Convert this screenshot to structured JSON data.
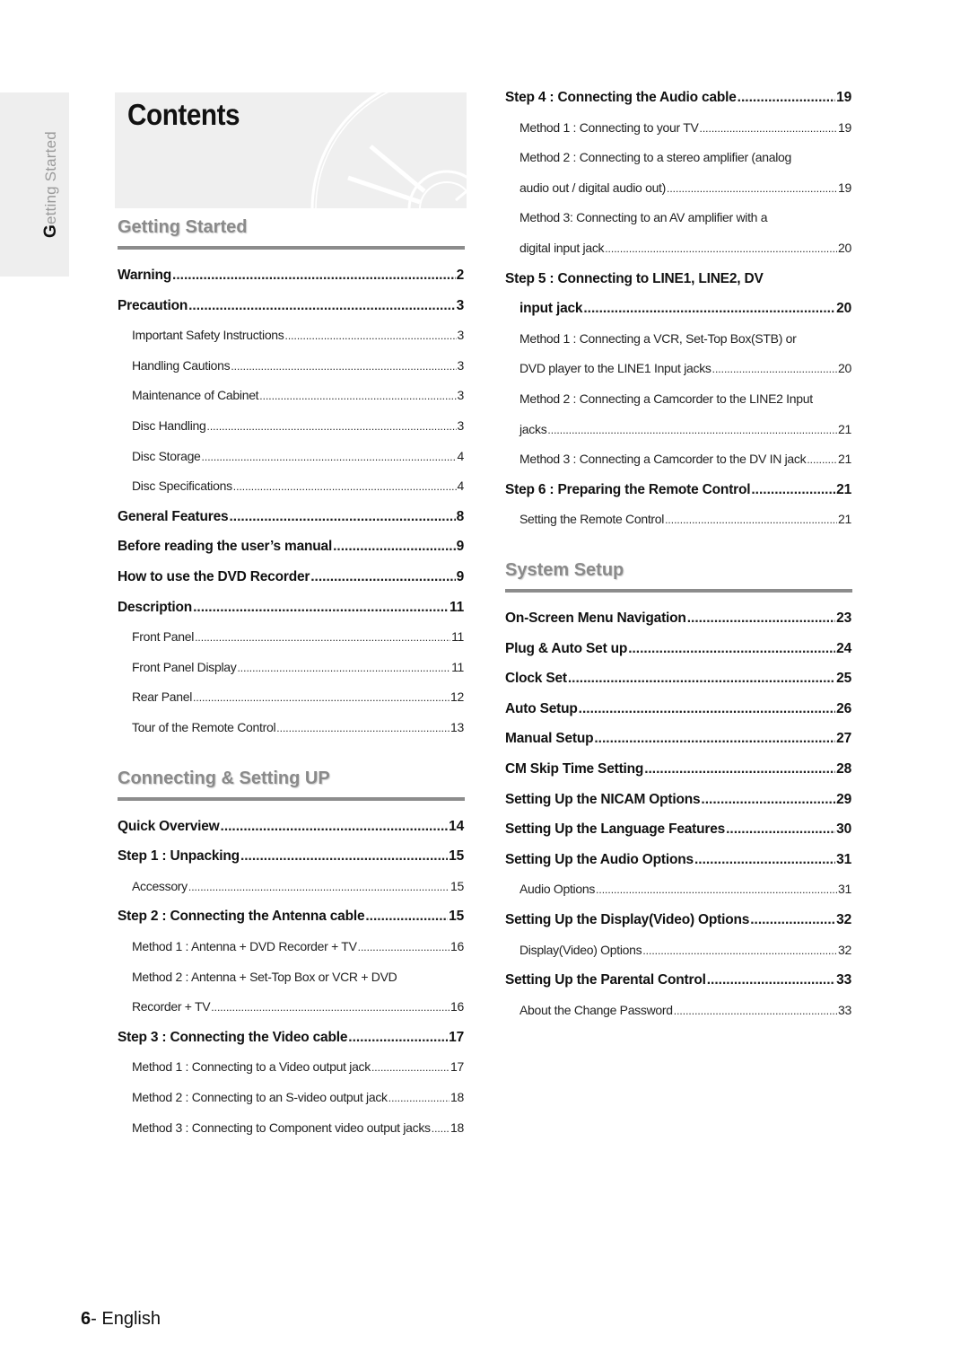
{
  "side_tab": {
    "initial": "G",
    "rest": "etting Started"
  },
  "header": {
    "title": "Contents",
    "graphic": "disc-icon"
  },
  "left_column": {
    "sections": [
      {
        "heading": "Getting Started",
        "entries": [
          {
            "level": 1,
            "title": "Warning",
            "page": "2"
          },
          {
            "level": 1,
            "title": "Precaution ",
            "page": "3"
          },
          {
            "level": 2,
            "title": "Important Safety Instructions",
            "page": "3"
          },
          {
            "level": 2,
            "title": "Handling Cautions",
            "page": "3"
          },
          {
            "level": 2,
            "title": "Maintenance of Cabinet",
            "page": "3"
          },
          {
            "level": 2,
            "title": "Disc Handling ",
            "page": "3"
          },
          {
            "level": 2,
            "title": "Disc Storage ",
            "page": "4"
          },
          {
            "level": 2,
            "title": "Disc Specifications ",
            "page": "4"
          },
          {
            "level": 1,
            "title": "General Features",
            "page": "8"
          },
          {
            "level": 1,
            "title": "Before reading the user’s manual ",
            "page": "9"
          },
          {
            "level": 1,
            "title": "How to use the DVD Recorder",
            "page": "9"
          },
          {
            "level": 1,
            "title": "Description",
            "page": "11"
          },
          {
            "level": 2,
            "title": "Front Panel ",
            "page": "11"
          },
          {
            "level": 2,
            "title": "Front Panel Display ",
            "page": "11"
          },
          {
            "level": 2,
            "title": "Rear Panel",
            "page": "12"
          },
          {
            "level": 2,
            "title": "Tour of the Remote Control ",
            "page": "13"
          }
        ]
      },
      {
        "heading": "Connecting & Setting UP",
        "entries": [
          {
            "level": 1,
            "title": "Quick Overview ",
            "page": "14"
          },
          {
            "level": 1,
            "title": "Step 1 : Unpacking",
            "page": "15"
          },
          {
            "level": 2,
            "title": "Accessory ",
            "page": "15"
          },
          {
            "level": 1,
            "title": "Step 2 : Connecting the Antenna cable ",
            "page": "15"
          },
          {
            "level": 2,
            "title": "Method 1 : Antenna + DVD Recorder + TV",
            "page": "16"
          },
          {
            "level": 2,
            "title": "Method 2 : Antenna + Set-Top Box or VCR + DVD",
            "page": ""
          },
          {
            "level": 2,
            "title": "Recorder + TV",
            "page": "16"
          },
          {
            "level": 1,
            "title": "Step 3 : Connecting the Video cable ",
            "page": "17"
          },
          {
            "level": 2,
            "title": "Method 1 : Connecting to a Video output jack ",
            "page": "17"
          },
          {
            "level": 2,
            "title": "Method 2 : Connecting to an S-video output jack",
            "page": "18"
          },
          {
            "level": 2,
            "title": "Method 3 : Connecting to Component video output jacks",
            "page": "18"
          }
        ]
      }
    ]
  },
  "right_column": {
    "entries": [
      {
        "level": 1,
        "title": "Step 4 : Connecting the Audio cable",
        "page": "19"
      },
      {
        "level": 2,
        "title": "Method 1 : Connecting to your TV ",
        "page": "19"
      },
      {
        "level": 2,
        "title": "Method 2 : Connecting to a stereo amplifier (analog",
        "page": ""
      },
      {
        "level": 2,
        "title": "audio out / digital audio out) ",
        "page": "19"
      },
      {
        "level": 2,
        "title": "Method 3: Connecting to an AV amplifier with a",
        "page": ""
      },
      {
        "level": 2,
        "title": "digital input jack",
        "page": "20"
      },
      {
        "level": 1,
        "title": "Step 5 : Connecting to LINE1, LINE2, DV",
        "page": ""
      },
      {
        "level": 1,
        "title": "input jack ",
        "page": "20",
        "continuation": true
      },
      {
        "level": 2,
        "title": "Method 1 : Connecting a VCR, Set-Top Box(STB) or",
        "page": ""
      },
      {
        "level": 2,
        "title": "DVD player to the LINE1 Input jacks ",
        "page": "20"
      },
      {
        "level": 2,
        "title": "Method 2 : Connecting a Camcorder to the LINE2 Input",
        "page": ""
      },
      {
        "level": 2,
        "title": "jacks",
        "page": "21"
      },
      {
        "level": 2,
        "title": "Method 3 : Connecting a Camcorder to the DV IN jack",
        "page": "21"
      },
      {
        "level": 1,
        "title": "Step 6 : Preparing the Remote Control",
        "page": "21"
      },
      {
        "level": 2,
        "title": "Setting the Remote Control",
        "page": "21"
      }
    ],
    "sections": [
      {
        "heading": "System Setup",
        "entries": [
          {
            "level": 1,
            "title": "On-Screen Menu Navigation",
            "page": "23"
          },
          {
            "level": 1,
            "title": "Plug & Auto Set up ",
            "page": "24"
          },
          {
            "level": 1,
            "title": "Clock Set ",
            "page": "25"
          },
          {
            "level": 1,
            "title": "Auto Setup ",
            "page": "26"
          },
          {
            "level": 1,
            "title": "Manual Setup",
            "page": "27"
          },
          {
            "level": 1,
            "title": "CM Skip Time Setting ",
            "page": "28"
          },
          {
            "level": 1,
            "title": "Setting Up the NICAM Options",
            "page": "29"
          },
          {
            "level": 1,
            "title": "Setting Up the Language Features",
            "page": "30"
          },
          {
            "level": 1,
            "title": "Setting Up the Audio Options",
            "page": "31"
          },
          {
            "level": 2,
            "title": "Audio Options",
            "page": "31"
          },
          {
            "level": 1,
            "title": "Setting Up the Display(Video) Options ",
            "page": "32"
          },
          {
            "level": 2,
            "title": "Display(Video) Options ",
            "page": "32"
          },
          {
            "level": 1,
            "title": "Setting Up the Parental Control",
            "page": "33"
          },
          {
            "level": 2,
            "title": "About the Change Password ",
            "page": "33"
          }
        ]
      }
    ]
  },
  "footer": {
    "page_number": "6",
    "separator": "-",
    "language": " English"
  },
  "colors": {
    "heading_gray": "#8a8a8a",
    "rule_gray": "#8c8c8c",
    "panel_bg": "#efefef",
    "text": "#111111"
  }
}
